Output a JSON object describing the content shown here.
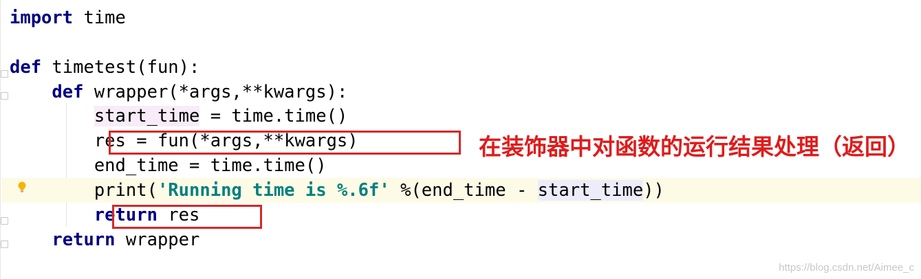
{
  "code": {
    "line1": {
      "kw": "import",
      "rest": " time"
    },
    "line3": {
      "kw": "def",
      "rest": " timetest(fun):"
    },
    "line4": {
      "indent": "    ",
      "kw": "def",
      "rest": " wrapper(*args,**kwargs):"
    },
    "line5": {
      "indent": "        ",
      "var": "start_time",
      "rest": " = time.time()"
    },
    "line6": {
      "indent": "        ",
      "text": "res = fun(*args,**kwargs)"
    },
    "line7": {
      "indent": "        ",
      "text": "end_time = time.time()"
    },
    "line8": {
      "indent": "        ",
      "fn": "print(",
      "str": "'Running time is %.6f'",
      "mid": " %(end_time - ",
      "var": "start_time",
      "end": "))"
    },
    "line9": {
      "indent": "        ",
      "kw": "return",
      "rest": " res"
    },
    "line10": {
      "indent": "    ",
      "kw": "return",
      "rest": " wrapper"
    }
  },
  "annotation": "在装饰器中对函数的运行结果处理（返回）",
  "watermark": "https://blog.csdn.net/Aimee_c",
  "colors": {
    "keyword": "#000080",
    "string": "#008080",
    "annotation_red": "#e01b1b",
    "box_red": "#d62828"
  },
  "icons": {
    "intention": "lightbulb-icon",
    "fold": "fold-marker-icon"
  }
}
